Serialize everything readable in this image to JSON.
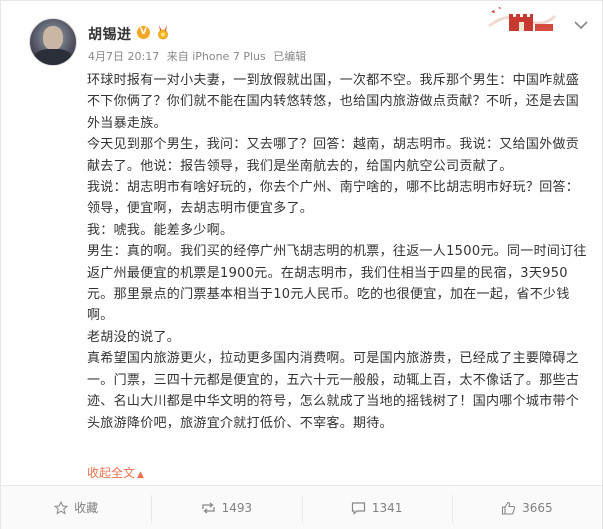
{
  "user": {
    "name": "胡锡进",
    "meta_date": "4月7日 20:17",
    "meta_source": "来自 iPhone 7 Plus",
    "meta_edited": "已编辑"
  },
  "post": {
    "paragraphs": [
      "环球时报有一对小夫妻，一到放假就出国，一次都不空。我斥那个男生：中国咋就盛不下你俩了？你们就不能在国内转悠转悠，也给国内旅游做点贡献？不听，还是去国外当暴走族。",
      "今天见到那个男生，我问：又去哪了？回答：越南，胡志明市。我说：又给国外做贡献去了。他说：报告领导，我们是坐南航去的，给国内航空公司贡献了。",
      "我说：胡志明市有啥好玩的，你去个广州、南宁啥的，哪不比胡志明市好玩？回答：领导，便宜啊，去胡志明市便宜多了。",
      "我：唬我。能差多少啊。",
      "男生：真的啊。我们买的经停广州飞胡志明的机票，往返一人1500元。同一时间订往返广州最便宜的机票是1900元。在胡志明市，我们住相当于四星的民宿，3天950元。那里景点的门票基本相当于10元人民币。吃的也很便宜，加在一起，省不少钱啊。",
      "老胡没的说了。",
      "真希望国内旅游更火，拉动更多国内消费啊。可是国内旅游贵，已经成了主要障碍之一。门票，三四十元都是便宜的，五六十元一般般，动辄上百，太不像话了。那些古迹、名山大川都是中华文明的符号，怎么就成了当地的摇钱树了！国内哪个城市带个头旅游降价吧，旅游宜介就打低价、不宰客。期待。"
    ],
    "collapse_label": "收起全文"
  },
  "actions": {
    "favorite_label": "收藏",
    "repost_count": "1493",
    "comment_count": "1341",
    "like_count": "3665"
  },
  "icons": {
    "avatar": "user-avatar",
    "verified": "verified-v-icon",
    "medal": "medal-icon",
    "banner": "great-wall-banner",
    "dropdown": "chevron-down-icon",
    "favorite": "star-icon",
    "repost": "repost-icon",
    "comment": "comment-icon",
    "like": "thumbs-up-icon"
  },
  "colors": {
    "accent": "#eb7350",
    "verified": "#f5a623",
    "muted": "#808080"
  }
}
